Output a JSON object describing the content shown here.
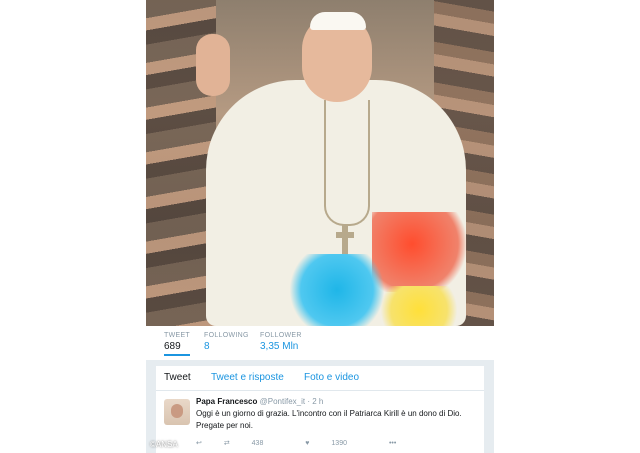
{
  "profile": {
    "stats": [
      {
        "label": "TWEET",
        "value": "689"
      },
      {
        "label": "FOLLOWING",
        "value": "8"
      },
      {
        "label": "FOLLOWER",
        "value": "3,35 Mln"
      }
    ]
  },
  "tabs": [
    "Tweet",
    "Tweet e risposte",
    "Foto e video"
  ],
  "tweet": {
    "name": "Papa Francesco",
    "handle": "@Pontifex_it",
    "time": "2 h",
    "text": "Oggi è un giorno di grazia. L'incontro con il Patriarca Kirill è un dono di Dio. Pregate per noi.",
    "retweets": "438",
    "likes": "1390"
  },
  "watermark": "©ANSA",
  "colors": {
    "accent": "#1b95e0",
    "background": "#e6ecf0"
  }
}
